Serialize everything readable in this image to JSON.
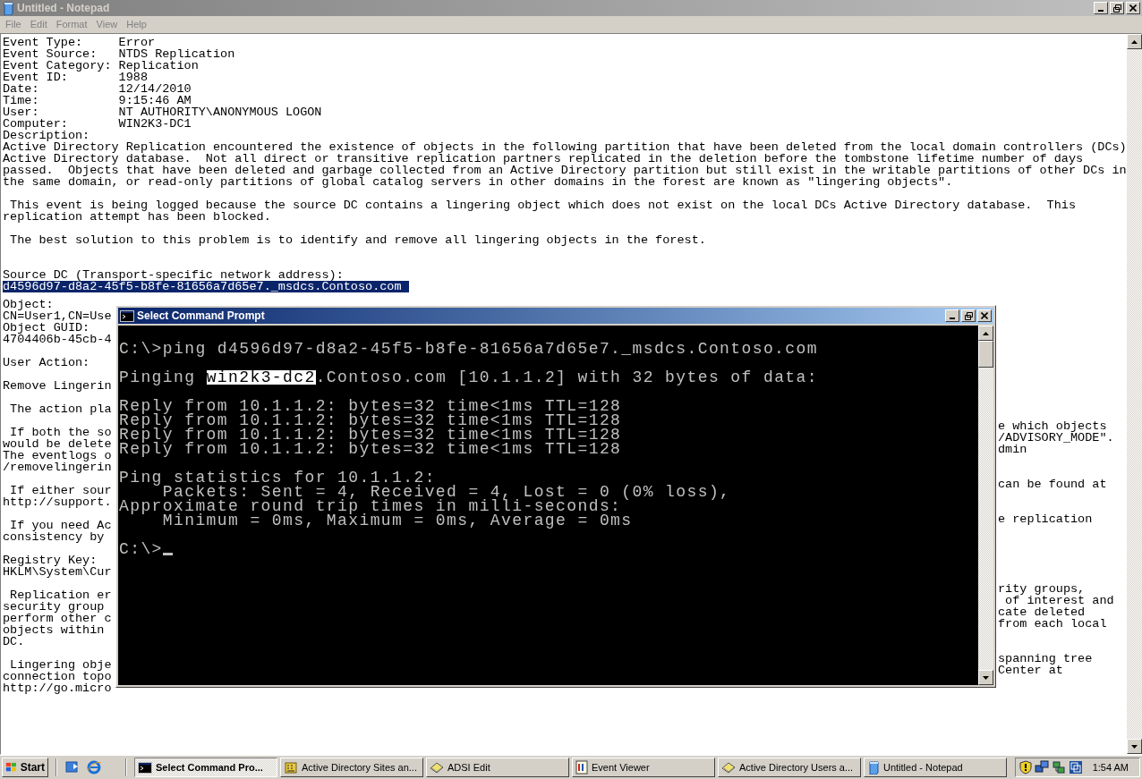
{
  "notepad": {
    "title": "Untitled - Notepad",
    "active": false,
    "menu": [
      {
        "label": "File"
      },
      {
        "label": "Edit"
      },
      {
        "label": "Format"
      },
      {
        "label": "View"
      },
      {
        "label": "Help"
      }
    ],
    "lines": [
      {
        "kind": "text",
        "text": "Event Type:     Error",
        "selected": false
      },
      {
        "kind": "text",
        "text": "Event Source:   NTDS Replication",
        "selected": false
      },
      {
        "kind": "text",
        "text": "Event Category: Replication",
        "selected": false
      },
      {
        "kind": "text",
        "text": "Event ID:       1988",
        "selected": false
      },
      {
        "kind": "text",
        "text": "Date:           12/14/2010",
        "selected": false
      },
      {
        "kind": "text",
        "text": "Time:           9:15:46 AM",
        "selected": false
      },
      {
        "kind": "text",
        "text": "User:           NT AUTHORITY\\ANONYMOUS LOGON",
        "selected": false
      },
      {
        "kind": "text",
        "text": "Computer:       WIN2K3-DC1",
        "selected": false
      },
      {
        "kind": "text",
        "text": "Description:",
        "selected": false
      },
      {
        "kind": "text",
        "text": "Active Directory Replication encountered the existence of objects in the following partition that have been deleted from the local domain controllers (DCs)",
        "selected": false
      },
      {
        "kind": "text",
        "text": "Active Directory database.  Not all direct or transitive replication partners replicated in the deletion before the tombstone lifetime number of days",
        "selected": false
      },
      {
        "kind": "text",
        "text": "passed.  Objects that have been deleted and garbage collected from an Active Directory partition but still exist in the writable partitions of other DCs in",
        "selected": false
      },
      {
        "kind": "text",
        "text": "the same domain, or read-only partitions of global catalog servers in other domains in the forest are known as \"lingering objects\".",
        "selected": false
      },
      {
        "kind": "blank"
      },
      {
        "kind": "text",
        "text": " This event is being logged because the source DC contains a lingering object which does not exist on the local DCs Active Directory database.  This",
        "selected": false
      },
      {
        "kind": "text",
        "text": "replication attempt has been blocked.",
        "selected": false
      },
      {
        "kind": "blank"
      },
      {
        "kind": "text",
        "text": " The best solution to this problem is to identify and remove all lingering objects in the forest.",
        "selected": false
      },
      {
        "kind": "blank"
      },
      {
        "kind": "blank"
      },
      {
        "kind": "text",
        "text": "Source DC (Transport-specific network address):",
        "selected": false
      },
      {
        "kind": "text",
        "text": "d4596d97-d8a2-45f5-b8fe-81656a7d65e7._msdcs.Contoso.com ",
        "selected": true
      }
    ],
    "partial_rows": [
      {
        "kind": "text",
        "left": "Object:"
      },
      {
        "kind": "text",
        "left": "CN=User1,CN=Use"
      },
      {
        "kind": "text",
        "left": "Object GUID:"
      },
      {
        "kind": "text",
        "left": "4704406b-45cb-4"
      },
      {
        "kind": "blank"
      },
      {
        "kind": "text",
        "left": "User Action:"
      },
      {
        "kind": "blank"
      },
      {
        "kind": "text",
        "left": "Remove Lingerin"
      },
      {
        "kind": "blank"
      },
      {
        "kind": "text",
        "left": " The action pla"
      },
      {
        "kind": "blank"
      },
      {
        "kind": "text",
        "left": " If both the so",
        "right": "e which objects"
      },
      {
        "kind": "text",
        "left": "would be delete",
        "right": "/ADVISORY_MODE\"."
      },
      {
        "kind": "text",
        "left": "The eventlogs o",
        "right": "dmin"
      },
      {
        "kind": "text",
        "left": "/removelingerin"
      },
      {
        "kind": "blank"
      },
      {
        "kind": "text",
        "left": " If either sour",
        "right": "can be found at"
      },
      {
        "kind": "text",
        "left": "http://support."
      },
      {
        "kind": "blank"
      },
      {
        "kind": "text",
        "left": " If you need Ac",
        "right": "e replication"
      },
      {
        "kind": "text",
        "left": "consistency by"
      },
      {
        "kind": "blank"
      },
      {
        "kind": "text",
        "left": "Registry Key:"
      },
      {
        "kind": "text",
        "left": "HKLM\\System\\Cur"
      },
      {
        "kind": "blank"
      },
      {
        "kind": "text",
        "left": " Replication er",
        "right": "rity groups,"
      },
      {
        "kind": "text",
        "left": "security group",
        "right": " of interest and"
      },
      {
        "kind": "text",
        "left": "perform other c",
        "right": "cate deleted"
      },
      {
        "kind": "text",
        "left": "objects within",
        "right": "from each local"
      },
      {
        "kind": "text",
        "left": "DC."
      },
      {
        "kind": "blank"
      },
      {
        "kind": "text",
        "left": " Lingering obje",
        "right": "spanning tree"
      },
      {
        "kind": "text",
        "left": "connection topo",
        "right": "Center at"
      },
      {
        "kind": "text",
        "left": "http://go.micro"
      }
    ]
  },
  "command_prompt": {
    "title": "Select Command Prompt",
    "active": true,
    "lines": [
      {
        "kind": "text",
        "text": "C:\\>ping d4596d97-d8a2-45f5-b8fe-81656a7d65e7._msdcs.Contoso.com"
      },
      {
        "kind": "blank"
      },
      {
        "kind": "mixed",
        "segments": [
          {
            "text": "Pinging ",
            "selected": false
          },
          {
            "text": "win2k3-dc2",
            "selected": true
          },
          {
            "text": ".Contoso.com [10.1.1.2] with 32 bytes of data:",
            "selected": false
          }
        ]
      },
      {
        "kind": "blank"
      },
      {
        "kind": "text",
        "text": "Reply from 10.1.1.2: bytes=32 time<1ms TTL=128"
      },
      {
        "kind": "text",
        "text": "Reply from 10.1.1.2: bytes=32 time<1ms TTL=128"
      },
      {
        "kind": "text",
        "text": "Reply from 10.1.1.2: bytes=32 time<1ms TTL=128"
      },
      {
        "kind": "text",
        "text": "Reply from 10.1.1.2: bytes=32 time<1ms TTL=128"
      },
      {
        "kind": "blank"
      },
      {
        "kind": "text",
        "text": "Ping statistics for 10.1.1.2:"
      },
      {
        "kind": "text",
        "text": "    Packets: Sent = 4, Received = 4, Lost = 0 (0% loss),"
      },
      {
        "kind": "text",
        "text": "Approximate round trip times in milli-seconds:"
      },
      {
        "kind": "text",
        "text": "    Minimum = 0ms, Maximum = 0ms, Average = 0ms"
      },
      {
        "kind": "blank"
      },
      {
        "kind": "prompt",
        "text": "C:\\>"
      }
    ]
  },
  "taskbar": {
    "start": "Start",
    "quick_launch": [
      {
        "kind": "desktop"
      },
      {
        "kind": "browser"
      }
    ],
    "tasks": [
      {
        "label": "Select Command Pro...",
        "kind": "console",
        "selected": true
      },
      {
        "label": "Active Directory Sites an...",
        "kind": "sites",
        "selected": false
      },
      {
        "label": "ADSI Edit",
        "kind": "tool",
        "selected": false
      },
      {
        "label": "Event Viewer",
        "kind": "viewer",
        "selected": false
      },
      {
        "label": "Active Directory Users a...",
        "kind": "tool",
        "selected": false
      },
      {
        "label": "Untitled - Notepad",
        "kind": "notepad",
        "selected": false
      }
    ],
    "tray": [
      {
        "kind": "shield"
      },
      {
        "kind": "computers"
      },
      {
        "kind": "network"
      },
      {
        "kind": "squares"
      }
    ],
    "clock": "1:54 AM"
  }
}
